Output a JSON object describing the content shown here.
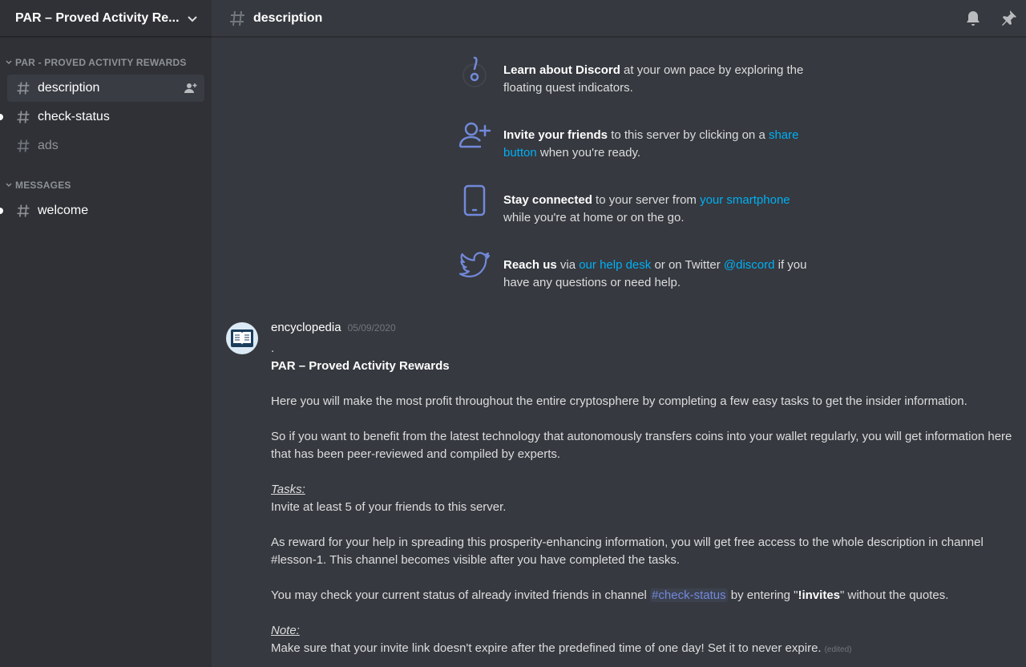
{
  "server": {
    "name": "PAR – Proved Activity Re..."
  },
  "sidebar": {
    "categories": [
      {
        "label": "PAR - PROVED ACTIVITY REWARDS",
        "channels": [
          {
            "label": "description",
            "selected": true
          },
          {
            "label": "check-status",
            "unread": true
          },
          {
            "label": "ads"
          }
        ]
      },
      {
        "label": "MESSAGES",
        "channels": [
          {
            "label": "welcome",
            "unread": true
          }
        ]
      }
    ]
  },
  "topbar": {
    "channel": "description"
  },
  "tips": [
    {
      "icon": "quest-icon",
      "bold": "Learn about Discord",
      "text": " at your own pace by exploring the floating quest indicators."
    },
    {
      "icon": "add-friend-icon",
      "bold": "Invite your friends",
      "text_before": " to this server by clicking on a ",
      "link": "share button",
      "text_after": " when you're ready."
    },
    {
      "icon": "smartphone-icon",
      "bold": "Stay connected",
      "text_before": " to your server from ",
      "link": "your smartphone",
      "text_after": " while you're at home or on the go."
    },
    {
      "icon": "twitter-icon",
      "bold": "Reach us",
      "text_before": " via ",
      "link": "our help desk",
      "text_mid": " or on Twitter ",
      "link2": "@discord",
      "text_after": " if you have any questions or need help."
    }
  ],
  "message": {
    "author": "encyclopedia",
    "timestamp": "05/09/2020",
    "line_dot": ".",
    "title": "PAR – Proved Activity Rewards",
    "p1": "Here you will make the most profit throughout the entire cryptosphere by completing a few easy tasks to get the insider information.",
    "p2": "So if you want to benefit from the latest technology that autonomously transfers coins into your wallet regularly, you will get information here that has been peer-reviewed and compiled by experts.",
    "tasks_label": "Tasks:",
    "tasks_text": "Invite at least 5 of your friends to this server.",
    "p3": "As reward for your help in spreading this prosperity-enhancing information, you will get free access to the whole description in channel #lesson-1. This channel becomes visible after you have completed the tasks.",
    "p4_before": "You may check your current status of already invited friends in channel ",
    "p4_mention": "#check-status",
    "p4_mid": " by entering \"",
    "p4_command": "!invites",
    "p4_after": "\" without the quotes.",
    "note_label": "Note:",
    "note_text": "Make sure that your invite link doesn't expire after the predefined time of one day! Set it to never expire.",
    "edited": "(edited)"
  },
  "colors": {
    "link": "#00aff4",
    "mention": "#7289da",
    "background": "#36393f",
    "sidebar": "#2f3136",
    "icon_accent": "#7289da"
  }
}
